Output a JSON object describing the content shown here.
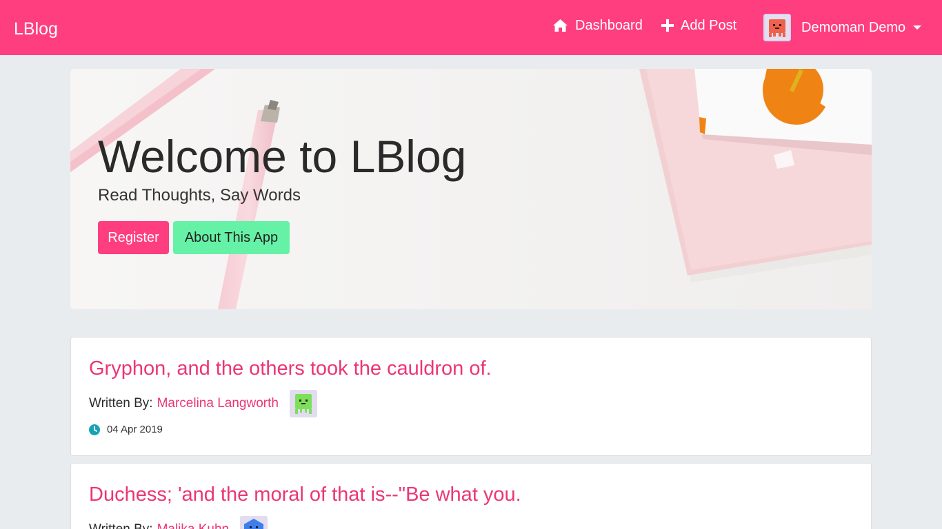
{
  "navbar": {
    "brand": "LBlog",
    "dashboard_label": "Dashboard",
    "add_post_label": "Add Post",
    "user_name": "Demoman Demo",
    "icons": {
      "dashboard": "home-icon",
      "add_post": "plus-icon",
      "menu": "caret-down-icon"
    },
    "background": "#ff3e7f"
  },
  "hero": {
    "title": "Welcome to LBlog",
    "subtitle": "Read Thoughts, Say Words",
    "register_label": "Register",
    "about_label": "About This App",
    "register_color": "#ff3e7f",
    "about_color": "#66f2a6"
  },
  "posts": [
    {
      "title": "Gryphon, and the others took the cauldron of.",
      "written_by_label": "Written By:",
      "author": "Marcelina Langworth",
      "date": "04 Apr 2019",
      "avatar_color": "#7ee05a"
    },
    {
      "title": "Duchess; 'and the moral of that is--\"Be what you.",
      "written_by_label": "Written By:",
      "author": "Malika Kuhn",
      "avatar_color": "#3f7ee8"
    }
  ],
  "accent_colors": {
    "link": "#ec3577",
    "clock": "#17a2b8",
    "page_bg": "#e9ecef"
  }
}
